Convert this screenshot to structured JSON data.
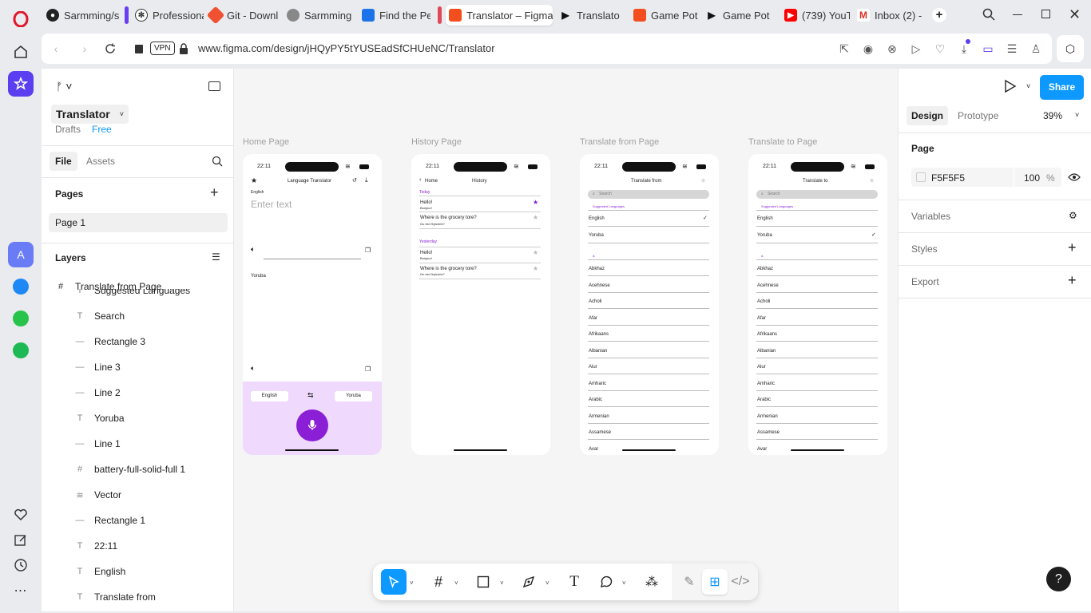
{
  "browser": {
    "tabs": [
      {
        "label": "Sarmming/s",
        "icon": "github-icon"
      },
      {
        "label": "Professiona",
        "icon": "chatgpt-icon"
      },
      {
        "label": "Git - Downl",
        "icon": "git-icon"
      },
      {
        "label": "Sarmming -",
        "icon": "globe-icon"
      },
      {
        "label": "Find the Pe",
        "icon": "bookmark-icon"
      },
      {
        "label": "Translator – Figma",
        "icon": "figma-icon"
      },
      {
        "label": "Translator",
        "icon": "play-icon"
      },
      {
        "label": "Game Pot -",
        "icon": "figma-icon"
      },
      {
        "label": "Game Pot",
        "icon": "play-icon"
      },
      {
        "label": "(739) YouTu",
        "icon": "youtube-icon"
      },
      {
        "label": "Inbox (2) -",
        "icon": "gmail-icon"
      }
    ],
    "url": "www.figma.com/design/jHQyPY5tYUSEadSfCHUeNC/Translator",
    "vpn_label": "VPN"
  },
  "left_panel": {
    "file_name": "Translator",
    "drafts": "Drafts",
    "plan": "Free",
    "tab_file": "File",
    "tab_assets": "Assets",
    "pages_title": "Pages",
    "page_1": "Page 1",
    "layers_title": "Layers",
    "selected_frame": "Translate from Page",
    "layers": [
      {
        "name": "Suggested Languages",
        "type": "T"
      },
      {
        "name": "Search",
        "type": "T"
      },
      {
        "name": "Rectangle 3",
        "type": "—"
      },
      {
        "name": "Line 3",
        "type": "—"
      },
      {
        "name": "Line 2",
        "type": "—"
      },
      {
        "name": "Yoruba",
        "type": "T"
      },
      {
        "name": "Line 1",
        "type": "—"
      },
      {
        "name": "battery-full-solid-full 1",
        "type": "#"
      },
      {
        "name": "Vector",
        "type": "wifi"
      },
      {
        "name": "Rectangle 1",
        "type": "—"
      },
      {
        "name": "22:11",
        "type": "T"
      },
      {
        "name": "English",
        "type": "T"
      },
      {
        "name": "Translate from",
        "type": "T"
      }
    ]
  },
  "canvas": {
    "frames": [
      {
        "label": "Home Page"
      },
      {
        "label": "History Page"
      },
      {
        "label": "Translate from Page"
      },
      {
        "label": "Translate to Page"
      }
    ],
    "status_time": "22:11",
    "home": {
      "title": "Language Translator",
      "source_lang": "English",
      "placeholder": "Enter text",
      "target_lang": "Yoruba",
      "btn_from": "English",
      "btn_to": "Yoruba"
    },
    "history": {
      "back": "Home",
      "title": "History",
      "today": "Today",
      "yesterday": "Yesterday",
      "entries": [
        {
          "text": "Hello!",
          "trans": "Bonjour!"
        },
        {
          "text": "Where is the grocery tore?",
          "trans": "Ou est l'épicerie?"
        },
        {
          "text": "Hello!",
          "trans": "Bonjour!"
        },
        {
          "text": "Where is the grocery tore?",
          "trans": "Ou est l'épicerie?"
        }
      ]
    },
    "translate_from": {
      "title": "Translate from",
      "search": "Search",
      "suggested": "Suggested Languages",
      "suggested_items": [
        "English",
        "Yoruba"
      ],
      "section_letter": "A",
      "languages": [
        "Abkhaz",
        "Acehnese",
        "Acholi",
        "Afar",
        "Afrikaans",
        "Albanian",
        "Alur",
        "Amharic",
        "Arabic",
        "Armenian",
        "Assamese",
        "Avar"
      ]
    },
    "translate_to": {
      "title": "Translate to",
      "search": "Search",
      "suggested": "Suggested Languages",
      "suggested_items": [
        "English",
        "Yoruba"
      ],
      "section_letter": "A",
      "languages": [
        "Abkhaz",
        "Acehnese",
        "Acholi",
        "Afar",
        "Afrikaans",
        "Albanian",
        "Alur",
        "Amharic",
        "Arabic",
        "Armenian",
        "Assamese",
        "Avar"
      ]
    }
  },
  "right_panel": {
    "share": "Share",
    "tab_design": "Design",
    "tab_prototype": "Prototype",
    "zoom": "39%",
    "page_title": "Page",
    "page_color": "F5F5F5",
    "page_opacity": "100",
    "percent": "%",
    "variables": "Variables",
    "styles": "Styles",
    "export": "Export"
  },
  "colors": {
    "accent": "#0d99ff",
    "purple": "#8a1fd6",
    "home_bottom": "#efd9fc"
  }
}
